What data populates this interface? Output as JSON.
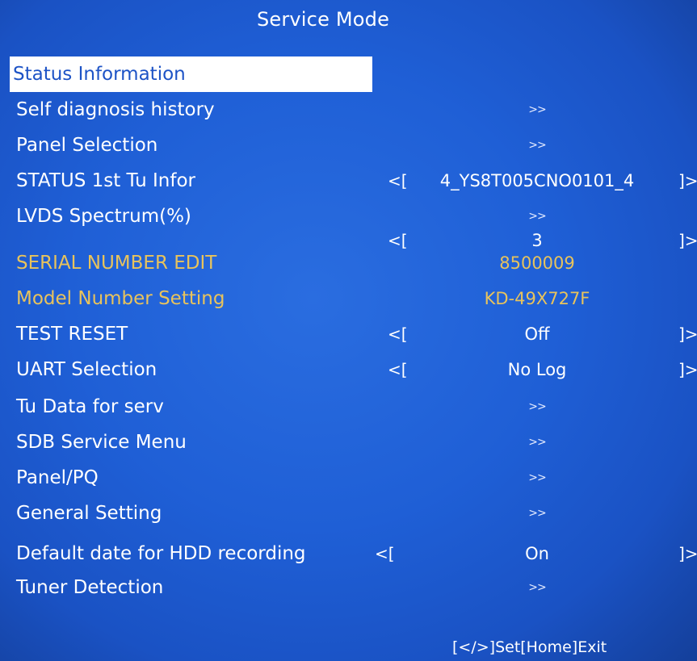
{
  "title": "Service Mode",
  "left_bracket": "<[",
  "right_bracket": "]>",
  "items": [
    {
      "label": "Status Information",
      "value": ""
    },
    {
      "label": "Self diagnosis history",
      "value": ">>"
    },
    {
      "label": "Panel Selection",
      "value": ">>"
    },
    {
      "label": "STATUS 1st Tu Infor",
      "value": "4_YS8T005CNO0101_4"
    },
    {
      "label": "LVDS Spectrum(%)",
      "value": ">>"
    },
    {
      "label": "",
      "value": "3"
    },
    {
      "label": "SERIAL NUMBER EDIT",
      "value": "8500009"
    },
    {
      "label": "Model Number Setting",
      "value": "KD-49X727F"
    },
    {
      "label": "TEST RESET",
      "value": "Off"
    },
    {
      "label": "UART Selection",
      "value": "No Log"
    },
    {
      "label": "Tu Data for serv",
      "value": ">>"
    },
    {
      "label": "SDB Service Menu",
      "value": ">>"
    },
    {
      "label": "Panel/PQ",
      "value": ">>"
    },
    {
      "label": "General Setting",
      "value": ">>"
    },
    {
      "label": "Default date for HDD recording",
      "value": "On"
    },
    {
      "label": "Tuner Detection",
      "value": ">>"
    }
  ],
  "footer": "[</>]Set[Home]Exit",
  "colors": {
    "background": "#1f5fd6",
    "text": "#ffffff",
    "highlight_bg": "#ffffff",
    "highlight_text": "#1d53c6",
    "gold": "#e8c35c"
  }
}
